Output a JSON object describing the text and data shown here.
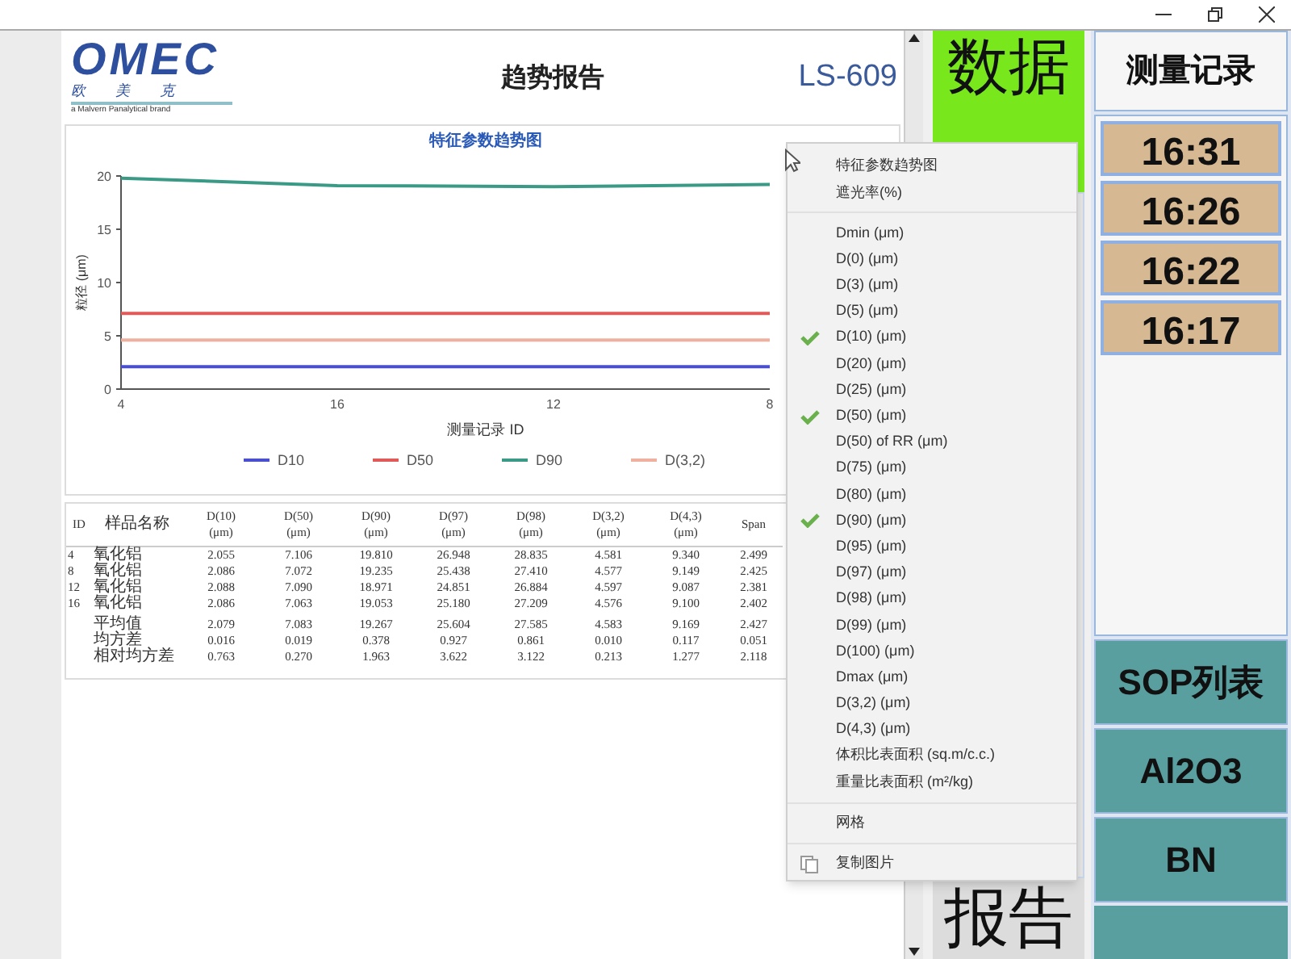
{
  "report": {
    "logo": "OMEC",
    "logo_cn": "欧 美 克",
    "brand": "a Malvern Panalytical brand",
    "title": "趋势报告",
    "model": "LS-609",
    "chart_data": {
      "type": "line",
      "title": "特征参数趋势图",
      "xlabel": "测量记录 ID",
      "ylabel": "粒径 (μm)",
      "categories": [
        "4",
        "16",
        "12",
        "8"
      ],
      "ylim": [
        0,
        20
      ],
      "yticks": [
        0,
        5,
        10,
        15,
        20
      ],
      "legend": true,
      "series": [
        {
          "name": "D10",
          "color": "#4a4fd0",
          "values": [
            2.1,
            2.1,
            2.1,
            2.1
          ]
        },
        {
          "name": "D50",
          "color": "#e05a5a",
          "values": [
            7.1,
            7.1,
            7.1,
            7.1
          ]
        },
        {
          "name": "D90",
          "color": "#3a9a86",
          "values": [
            19.8,
            19.1,
            19.0,
            19.2
          ]
        },
        {
          "name": "D(3,2)",
          "color": "#f0b0a0",
          "values": [
            4.6,
            4.6,
            4.6,
            4.6
          ]
        }
      ]
    },
    "table": {
      "columns": [
        "ID",
        "样品名称",
        "D(10)\n(μm)",
        "D(50)\n(μm)",
        "D(90)\n(μm)",
        "D(97)\n(μm)",
        "D(98)\n(μm)",
        "D(3,2)\n(μm)",
        "D(4,3)\n(μm)",
        "Span"
      ],
      "rows": [
        [
          "4",
          "氧化铝",
          "2.055",
          "7.106",
          "19.810",
          "26.948",
          "28.835",
          "4.581",
          "9.340",
          "2.499"
        ],
        [
          "8",
          "氧化铝",
          "2.086",
          "7.072",
          "19.235",
          "25.438",
          "27.410",
          "4.577",
          "9.149",
          "2.425"
        ],
        [
          "12",
          "氧化铝",
          "2.088",
          "7.090",
          "18.971",
          "24.851",
          "26.884",
          "4.597",
          "9.087",
          "2.381"
        ],
        [
          "16",
          "氧化铝",
          "2.086",
          "7.063",
          "19.053",
          "25.180",
          "27.209",
          "4.576",
          "9.100",
          "2.402"
        ]
      ],
      "summary": [
        [
          "平均值",
          "2.079",
          "7.083",
          "19.267",
          "25.604",
          "27.585",
          "4.583",
          "9.169",
          "2.427"
        ],
        [
          "均方差",
          "0.016",
          "0.019",
          "0.378",
          "0.927",
          "0.861",
          "0.010",
          "0.117",
          "0.051"
        ],
        [
          "相对均方差",
          "0.763",
          "0.270",
          "1.963",
          "3.622",
          "3.122",
          "0.213",
          "1.277",
          "2.118"
        ]
      ]
    }
  },
  "status": {
    "lines": [
      "数据"
    ]
  },
  "report_button": "报告",
  "records": {
    "title": "测量记录",
    "items": [
      {
        "time": "16:31",
        "selected": false
      },
      {
        "time": "16:26",
        "selected": false
      },
      {
        "time": "16:22",
        "selected": false
      },
      {
        "time": "16:17",
        "selected": false
      }
    ]
  },
  "sample_buttons": [
    "SOP列表",
    "Al2O3",
    "BN"
  ],
  "context_menu": {
    "groups": [
      [
        {
          "label": "特征参数趋势图",
          "kind": "option",
          "checked": false
        },
        {
          "label": "遮光率(%)",
          "kind": "option",
          "checked": false
        }
      ],
      [
        {
          "label": "Dmin (μm)",
          "kind": "option",
          "checked": false
        },
        {
          "label": "D(0) (μm)",
          "kind": "option",
          "checked": false
        },
        {
          "label": "D(3) (μm)",
          "kind": "option",
          "checked": false
        },
        {
          "label": "D(5) (μm)",
          "kind": "option",
          "checked": false
        },
        {
          "label": "D(10) (μm)",
          "kind": "option",
          "checked": true
        },
        {
          "label": "D(20) (μm)",
          "kind": "option",
          "checked": false
        },
        {
          "label": "D(25) (μm)",
          "kind": "option",
          "checked": false
        },
        {
          "label": "D(50) (μm)",
          "kind": "option",
          "checked": true
        },
        {
          "label": "D(50) of RR (μm)",
          "kind": "option",
          "checked": false
        },
        {
          "label": "D(75) (μm)",
          "kind": "option",
          "checked": false
        },
        {
          "label": "D(80) (μm)",
          "kind": "option",
          "checked": false
        },
        {
          "label": "D(90) (μm)",
          "kind": "option",
          "checked": true
        },
        {
          "label": "D(95) (μm)",
          "kind": "option",
          "checked": false
        },
        {
          "label": "D(97) (μm)",
          "kind": "option",
          "checked": false
        },
        {
          "label": "D(98) (μm)",
          "kind": "option",
          "checked": false
        },
        {
          "label": "D(99) (μm)",
          "kind": "option",
          "checked": false
        },
        {
          "label": "D(100) (μm)",
          "kind": "option",
          "checked": false
        },
        {
          "label": "Dmax (μm)",
          "kind": "option",
          "checked": false
        },
        {
          "label": "D(3,2) (μm)",
          "kind": "option",
          "checked": false
        },
        {
          "label": "D(4,3) (μm)",
          "kind": "option",
          "checked": false
        },
        {
          "label": "体积比表面积 (sq.m/c.c.)",
          "kind": "option",
          "checked": false
        },
        {
          "label": "重量比表面积 (m²/kg)",
          "kind": "option",
          "checked": false
        }
      ],
      [
        {
          "label": "网格",
          "kind": "option",
          "checked": false
        }
      ],
      [
        {
          "label": "复制图片",
          "kind": "command",
          "checked": false
        }
      ]
    ]
  }
}
